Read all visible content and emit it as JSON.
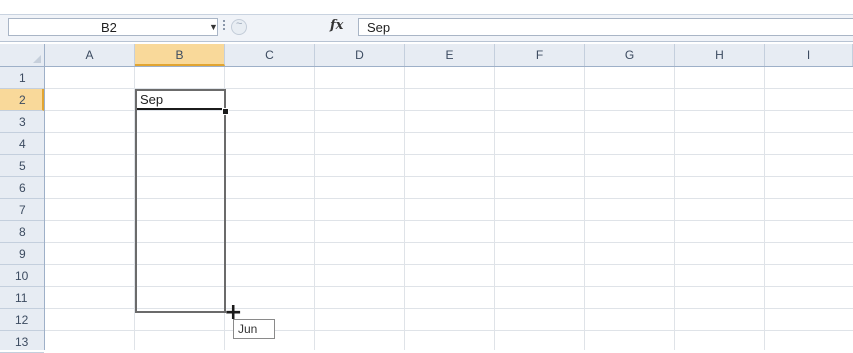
{
  "formula_bar": {
    "name_box_value": "B2",
    "fx_label": "fx",
    "formula_value": "Sep"
  },
  "columns": [
    "A",
    "B",
    "C",
    "D",
    "E",
    "F",
    "G",
    "H",
    "I"
  ],
  "selected_column": "B",
  "rows": [
    "1",
    "2",
    "3",
    "4",
    "5",
    "6",
    "7",
    "8",
    "9",
    "10",
    "11",
    "12",
    "13"
  ],
  "selected_row": "2",
  "cells": {
    "B2": "Sep"
  },
  "fill_tooltip": "Jun"
}
